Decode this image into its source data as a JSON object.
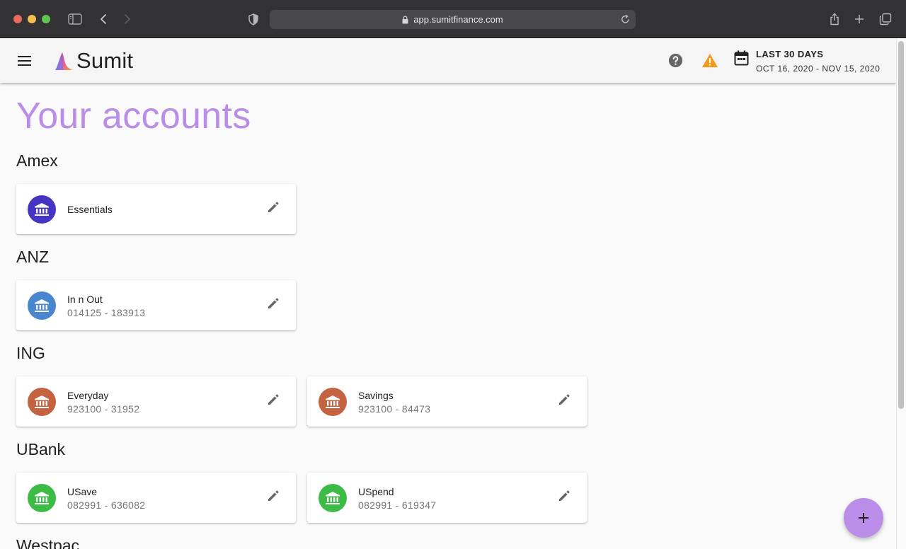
{
  "browser": {
    "url": "app.sumitfinance.com"
  },
  "appbar": {
    "logo_text": "Sumit",
    "date_filter": {
      "title": "LAST 30 DAYS",
      "range": "OCT 16, 2020 - NOV 15, 2020"
    }
  },
  "page": {
    "title": "Your accounts"
  },
  "groups": [
    {
      "name": "Amex",
      "accounts": [
        {
          "name": "Essentials",
          "number": "",
          "color": "#4535c4"
        }
      ]
    },
    {
      "name": "ANZ",
      "accounts": [
        {
          "name": "In n Out",
          "number": "014125 - 183913",
          "color": "#4a86cf"
        }
      ]
    },
    {
      "name": "ING",
      "accounts": [
        {
          "name": "Everyday",
          "number": "923100 - 31952",
          "color": "#c5623f"
        },
        {
          "name": "Savings",
          "number": "923100 - 84473",
          "color": "#c5623f"
        }
      ]
    },
    {
      "name": "UBank",
      "accounts": [
        {
          "name": "USave",
          "number": "082991 - 636082",
          "color": "#3cbc45"
        },
        {
          "name": "USpend",
          "number": "082991 - 619347",
          "color": "#3cbc45"
        }
      ]
    },
    {
      "name": "Westpac",
      "accounts": []
    }
  ],
  "colors": {
    "accent": "#b98de8",
    "warning": "#f29a1e"
  },
  "icons": {
    "menu": "menu-icon",
    "help": "help-icon",
    "warning": "warning-icon",
    "calendar": "calendar-icon",
    "account": "bank-icon",
    "edit": "pencil-icon",
    "add": "plus-icon"
  }
}
